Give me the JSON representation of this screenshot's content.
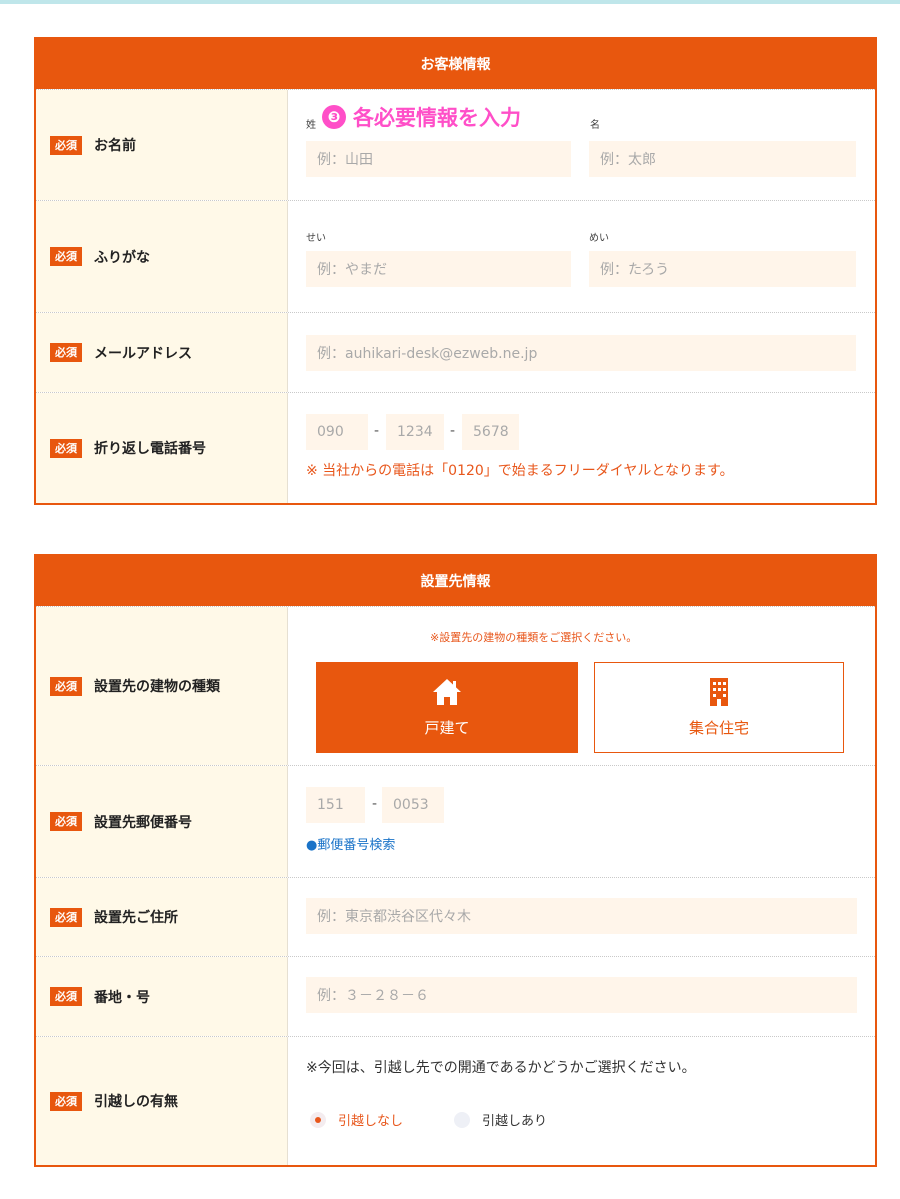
{
  "customer": {
    "title": "お客様情報",
    "required_badge": "必須",
    "step_annotation": {
      "number": "❸",
      "text": "各必要情報を入力"
    },
    "name": {
      "label": "お名前",
      "sei_caption": "姓",
      "mei_caption": "名",
      "sei_placeholder": "例：山田",
      "mei_placeholder": "例：太郎"
    },
    "kana": {
      "label": "ふりがな",
      "sei_caption": "せい",
      "mei_caption": "めい",
      "sei_placeholder": "例：やまだ",
      "mei_placeholder": "例：たろう"
    },
    "email": {
      "label": "メールアドレス",
      "placeholder": "例：auhikari-desk@ezweb.ne.jp"
    },
    "phone": {
      "label": "折り返し電話番号",
      "part1": "090",
      "part2": "1234",
      "part3": "5678",
      "separator": "-",
      "note": "※ 当社からの電話は「0120」で始まるフリーダイヤルとなります。"
    }
  },
  "site": {
    "title": "設置先情報",
    "required_badge": "必須",
    "building": {
      "label": "設置先の建物の種類",
      "note": "※設置先の建物の種類をご選択ください。",
      "option_house": "戸建て",
      "option_apartment": "集合住宅",
      "selected": "戸建て",
      "house_icon": "house-icon",
      "apartment_icon": "building-icon"
    },
    "postal": {
      "label": "設置先郵便番号",
      "part1": "151",
      "part2": "0053",
      "separator": "-",
      "search_link": "●郵便番号検索"
    },
    "address": {
      "label": "設置先ご住所",
      "placeholder": "例：東京都渋谷区代々木"
    },
    "number": {
      "label": "番地・号",
      "placeholder": "例：３－２８－６"
    },
    "moving": {
      "label": "引越しの有無",
      "question": "※今回は、引越し先での開通であるかどうかご選択ください。",
      "option_no": "引越しなし",
      "option_yes": "引越しあり",
      "selected": "引越しなし"
    }
  },
  "colors": {
    "accent": "#e8570e",
    "label_bg": "#fff9e8",
    "input_bg": "#fff5ea",
    "annotation": "#ff4fc8",
    "link": "#1a73c8"
  }
}
